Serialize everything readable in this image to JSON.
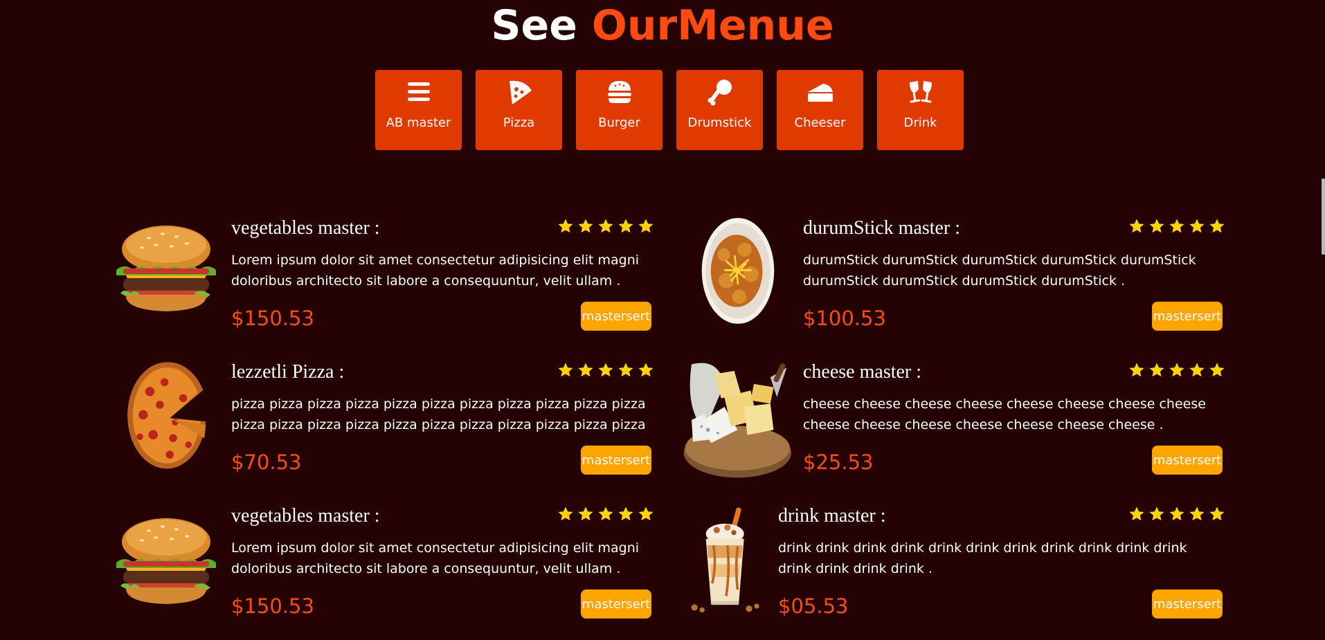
{
  "header": {
    "title_part1": "See ",
    "title_part2": "OurMenue",
    "accent_color": "#ff4a12"
  },
  "categories": [
    {
      "label": "AB master",
      "icon": "hamburger-menu-icon"
    },
    {
      "label": "Pizza",
      "icon": "pizza-slice-icon"
    },
    {
      "label": "Burger",
      "icon": "burger-icon"
    },
    {
      "label": "Drumstick",
      "icon": "drumstick-icon"
    },
    {
      "label": "Cheeser",
      "icon": "cheese-icon"
    },
    {
      "label": "Drink",
      "icon": "champagne-glasses-icon"
    }
  ],
  "items": [
    {
      "title": "vegetables master :",
      "description": "Lorem ipsum dolor sit amet consectetur adipisicing elit magni doloribus architecto sit labore a consequuntur, velit ullam .",
      "price": "$150.53",
      "button": "mastersert",
      "rating": 5,
      "image": "burger"
    },
    {
      "title": "durumStick master :",
      "description": "durumStick durumStick durumStick durumStick durumStick durumStick durumStick durumStick durumStick .",
      "price": "$100.53",
      "button": "mastersert",
      "rating": 5,
      "image": "fried-chicken-plate"
    },
    {
      "title": "lezzetli Pizza :",
      "description": "pizza pizza pizza pizza pizza pizza pizza pizza pizza pizza pizza pizza pizza pizza pizza pizza pizza pizza pizza pizza pizza pizza",
      "price": "$70.53",
      "button": "mastersert",
      "rating": 5,
      "image": "pizza"
    },
    {
      "title": "cheese master :",
      "description": "cheese cheese cheese cheese cheese cheese cheese cheese cheese cheese cheese cheese cheese cheese cheese .",
      "price": "$25.53",
      "button": "mastersert",
      "rating": 5,
      "image": "cheese-board"
    },
    {
      "title": "vegetables master :",
      "description": "Lorem ipsum dolor sit amet consectetur adipisicing elit magni doloribus architecto sit labore a consequuntur, velit ullam .",
      "price": "$150.53",
      "button": "mastersert",
      "rating": 5,
      "image": "burger"
    },
    {
      "title": "drink master :",
      "description": "drink drink drink drink drink drink drink drink drink drink drink drink drink drink drink .",
      "price": "$05.53",
      "button": "mastersert",
      "rating": 5,
      "image": "milkshake"
    }
  ],
  "colors": {
    "background": "#250304",
    "category_button": "#e03a00",
    "price": "#ff4a12",
    "order_button": "#ffa500",
    "star": "#ffd400"
  }
}
